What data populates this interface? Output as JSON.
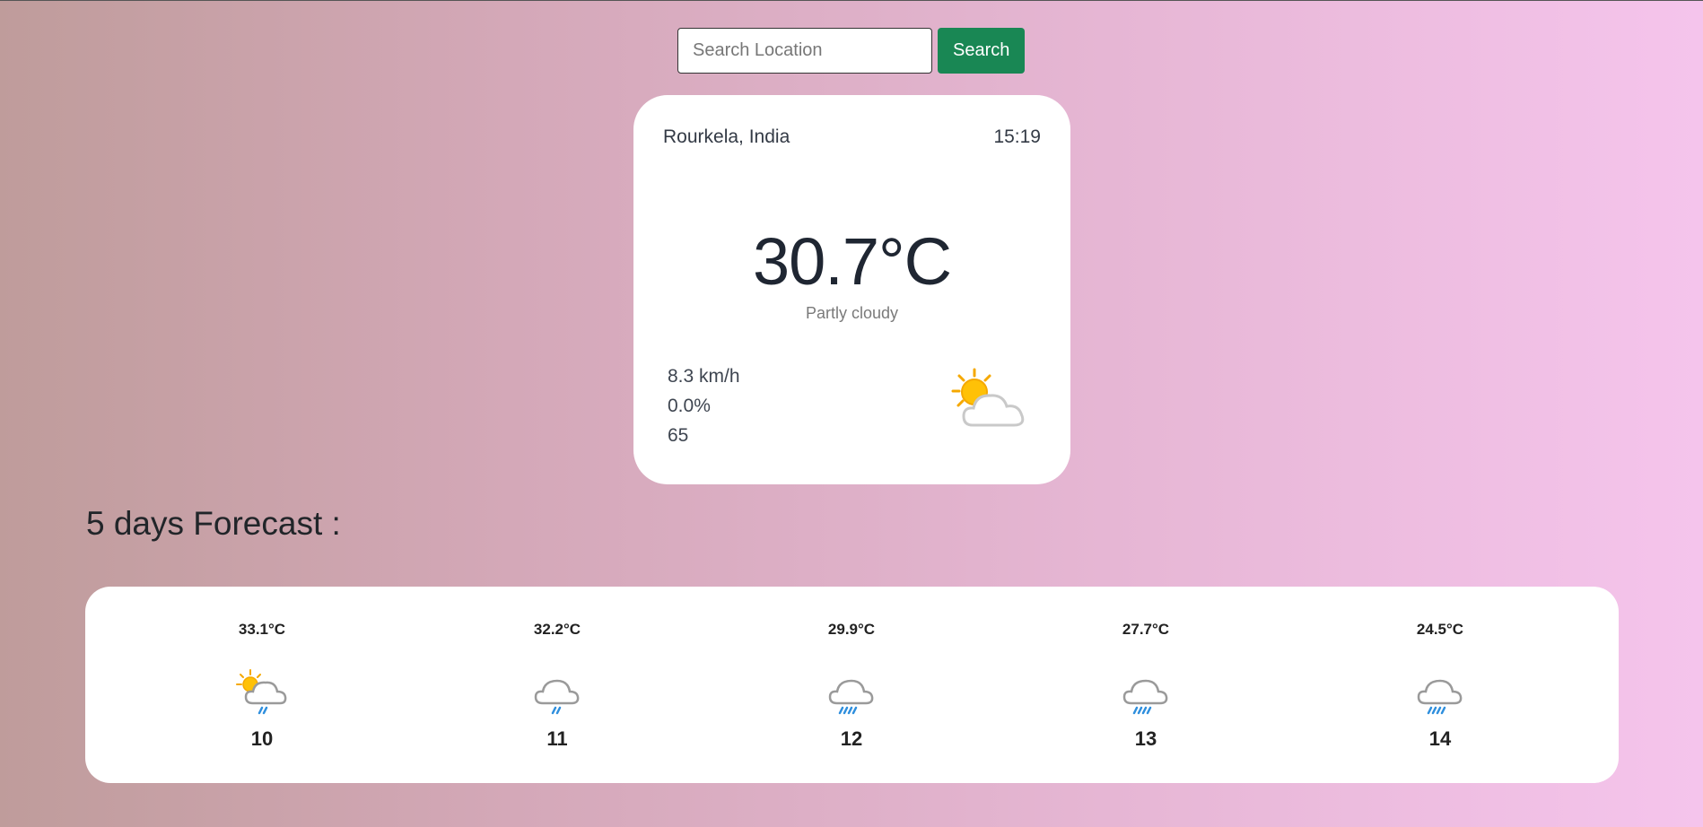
{
  "search": {
    "placeholder": "Search Location",
    "value": "",
    "button_label": "Search"
  },
  "current": {
    "location": "Rourkela, India",
    "time": "15:19",
    "temperature": "30.7°C",
    "condition": "Partly cloudy",
    "wind": "8.3 km/h",
    "precipitation": "0.0%",
    "humidity": "65",
    "icon": "partly-cloudy-icon"
  },
  "forecast": {
    "title": "5 days Forecast :",
    "days": [
      {
        "temp": "33.1°C",
        "day": "10",
        "icon": "sun-cloud-rain-icon"
      },
      {
        "temp": "32.2°C",
        "day": "11",
        "icon": "light-rain-icon"
      },
      {
        "temp": "29.9°C",
        "day": "12",
        "icon": "rain-icon"
      },
      {
        "temp": "27.7°C",
        "day": "13",
        "icon": "rain-icon"
      },
      {
        "temp": "24.5°C",
        "day": "14",
        "icon": "rain-icon"
      }
    ]
  },
  "colors": {
    "accent": "#198754",
    "gradient_start": "#bf9c9b",
    "gradient_end": "#f5c4ec"
  }
}
